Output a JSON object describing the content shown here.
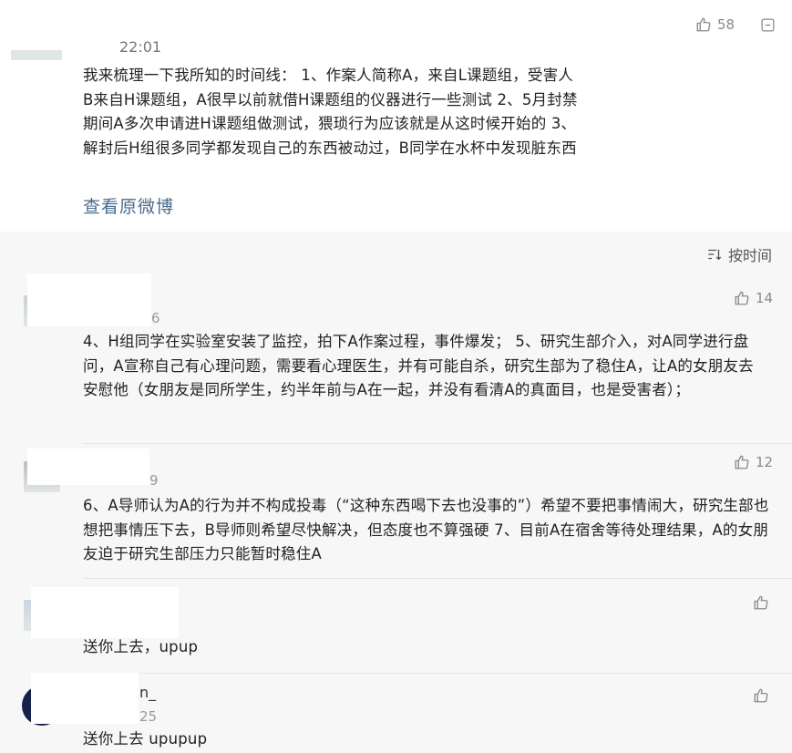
{
  "main_comment": {
    "time": "22:01",
    "likes": "58",
    "text": "我来梳理一下我所知的时间线： 1、作案人简称A，来自L课题组，受害人B来自H课题组，A很早以前就借H课题组的仪器进行一些测试 2、5月封禁期间A多次申请进H课题组做测试，猥琐行为应该就是从这时候开始的 3、解封后H组很多同学都发现自己的东西被动过，B同学在水杯中发现脏东西",
    "view_original": "查看原微博"
  },
  "replies_header": {
    "sort_label": "按时间"
  },
  "replies": [
    {
      "meta_fragment": "6",
      "likes": "14",
      "text": "4、H组同学在实验室安装了监控，拍下A作案过程，事件爆发； 5、研究生部介入，对A同学进行盘问，A宣称自己有心理问题，需要看心理医生，并有可能自杀，研究生部为了稳住A，让A的女朋友去安慰他（女朋友是同所学生，约半年前与A在一起，并没有看清A的真面目，也是受害者）；"
    },
    {
      "meta_fragment": "9",
      "likes": "12",
      "text": "6、A导师认为A的行为并不构成投毒（“这种东西喝下去也没事的”）希望不要把事情闹大，研究生部也想把事情压下去，B导师则希望尽快解决，但态度也不算强硬 7、目前A在宿舍等待处理结果，A的女朋友迫于研究生部压力只能暂时稳住A"
    },
    {
      "meta_fragment": "",
      "likes": "",
      "text": "送你上去，upup"
    },
    {
      "name_fragment": "n_",
      "meta_fragment": "25",
      "likes": "",
      "text": "送你上去 upupup"
    }
  ],
  "icons": {
    "thumb": "thumbs-up-icon",
    "more": "more-icon",
    "sort": "sort-icon"
  },
  "colors": {
    "link": "#4a6b8c",
    "reply_bg": "#f7f7f7",
    "icon_gray": "#8a8a8a"
  }
}
